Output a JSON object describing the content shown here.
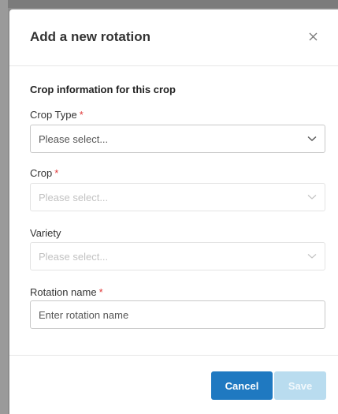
{
  "modal": {
    "title": "Add a new rotation",
    "close_icon": "close-icon",
    "section_title": "Crop information for this crop"
  },
  "fields": {
    "crop_type": {
      "label": "Crop Type",
      "required_mark": "*",
      "value": "Please select..."
    },
    "crop": {
      "label": "Crop",
      "required_mark": "*",
      "value": "Please select...",
      "disabled": true
    },
    "variety": {
      "label": "Variety",
      "value": "Please select...",
      "disabled": true
    },
    "rotation_name": {
      "label": "Rotation name",
      "required_mark": "*",
      "placeholder": "Enter rotation name"
    }
  },
  "footer": {
    "cancel_label": "Cancel",
    "save_label": "Save",
    "save_disabled": true
  },
  "colors": {
    "primary": "#1f79c1",
    "primary_disabled": "#b9dcef",
    "required": "#e03a3a"
  }
}
